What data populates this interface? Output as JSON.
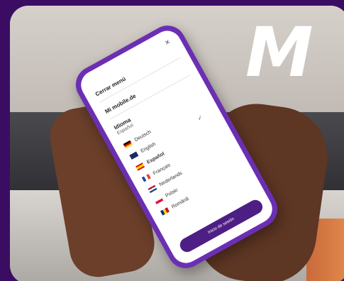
{
  "brand": {
    "logo_text": "M"
  },
  "menu": {
    "close_title": "Cerrar menú",
    "site": "Mi mobile.de",
    "language_label": "Idioma",
    "current_language": "Español",
    "languages": [
      "Deutsch",
      "English",
      "Español",
      "Français",
      "Nederlands",
      "Polski",
      "Română"
    ],
    "login_button": "Inicio de sesión"
  },
  "colors": {
    "frame": "#3a0d63",
    "phone": "#6b2fb3",
    "button": "#4d1f85"
  }
}
